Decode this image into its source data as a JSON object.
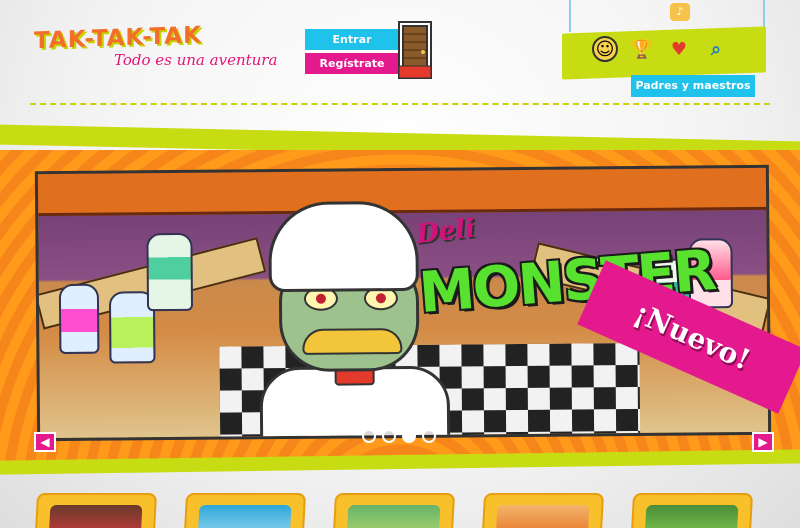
{
  "logo": {
    "name": "TAK-TAK-TAK",
    "tagline": "Todo es una aventura"
  },
  "auth": {
    "login_label": "Entrar",
    "register_label": "Regístrate"
  },
  "top_nav": {
    "icons": [
      "smiley-icon",
      "trophy-icon",
      "heart-icon",
      "magnifier-icon"
    ],
    "speaker_icon": "speaker-icon",
    "parents_label": "Padres y maestros"
  },
  "banner": {
    "title_small": "Deli",
    "title_big": "MONSTER",
    "ribbon": "¡Nuevo!",
    "slides_count": 4,
    "active_slide": 3
  },
  "games": [
    "game-1",
    "game-2",
    "game-3",
    "game-4",
    "game-5"
  ],
  "colors": {
    "orange": "#f26f2b",
    "magenta": "#e4198e",
    "cyan": "#1ec2ea",
    "lime": "#c7dc12",
    "yellow": "#f8c02a"
  }
}
